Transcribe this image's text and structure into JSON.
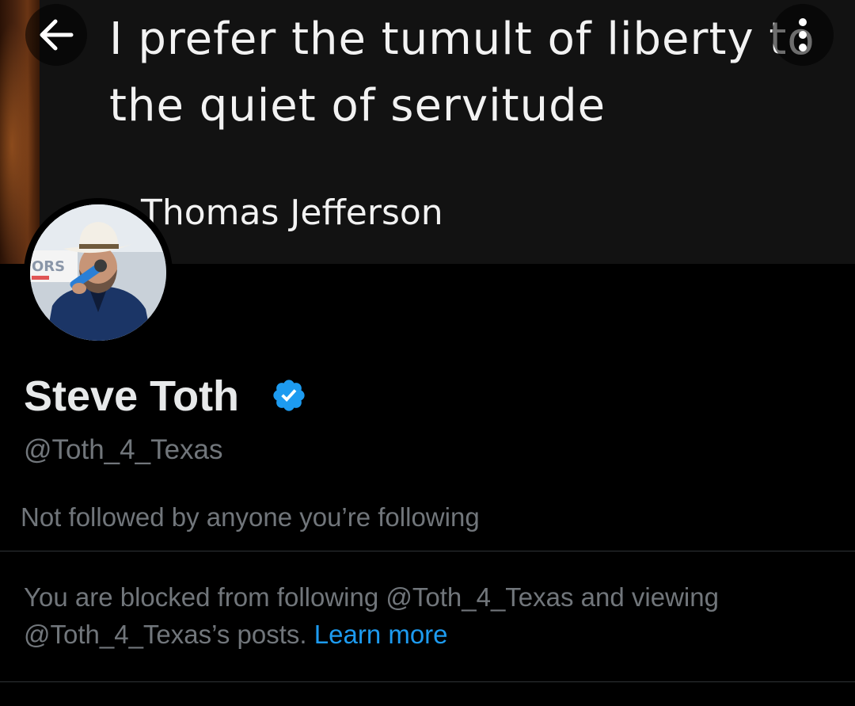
{
  "banner": {
    "quote_line_1": "I prefer the tumult of liberty to",
    "quote_line_2": "the quiet of servitude",
    "quote_author": "Thomas Jefferson",
    "avatar_sign_text": "ORS"
  },
  "toolbar": {
    "back_icon": "arrow-left-icon",
    "more_icon": "more-vertical-icon"
  },
  "profile": {
    "display_name": "Steve Toth",
    "verified_icon": "verified-badge-icon",
    "handle": "@Toth_4_Texas",
    "followers_note": "Not followed by anyone you’re following"
  },
  "blocked": {
    "message": "You are blocked from following @Toth_4_Texas and viewing @Toth_4_Texas’s posts.",
    "link_label": "Learn more"
  },
  "colors": {
    "background": "#000000",
    "text_primary": "#e7e9ea",
    "text_secondary": "#71767b",
    "link": "#1d9bf0",
    "verified": "#1d9bf0",
    "divider": "#2f3336"
  }
}
